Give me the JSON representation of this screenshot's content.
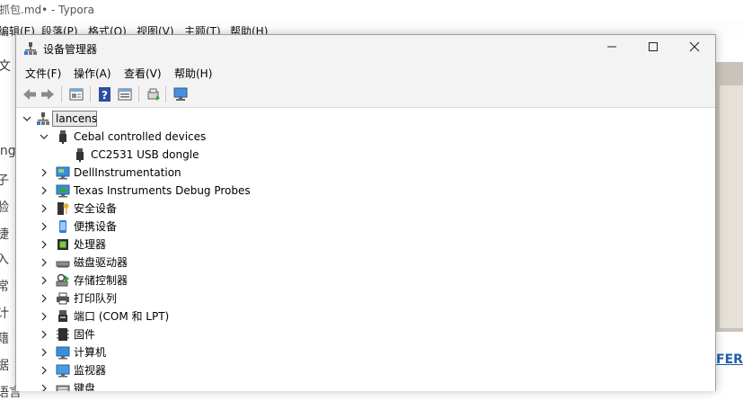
{
  "background_app": {
    "title": "抓包.md• - Typora",
    "menu": [
      "编辑(E)",
      "段落(P)",
      "格式(O)",
      "视图(V)",
      "主题(T)",
      "帮助(H)"
    ],
    "side_tab": "文",
    "side_chars": [
      "ing",
      "子",
      "验",
      "捷",
      "入",
      "常",
      "计",
      "籍",
      "据",
      "语言"
    ],
    "right_link": "FER"
  },
  "window": {
    "title": "设备管理器",
    "controls": {
      "minimize": "—",
      "maximize": "☐",
      "close": "✕"
    }
  },
  "menubar": [
    "文件(F)",
    "操作(A)",
    "查看(V)",
    "帮助(H)"
  ],
  "toolbar": {
    "icons": [
      "back-icon",
      "forward-icon",
      "properties-icon",
      "help-icon",
      "device-view-icon",
      "scan-hardware-icon",
      "monitor-icon"
    ]
  },
  "tree": {
    "root": "lancens",
    "nodes": [
      {
        "label": "Cebal controlled devices",
        "level": 1,
        "expanded": true,
        "icon": "usb-plug-icon"
      },
      {
        "label": "CC2531 USB dongle",
        "level": 2,
        "expanded": null,
        "icon": "usb-plug-icon"
      },
      {
        "label": "DellInstrumentation",
        "level": 1,
        "expanded": false,
        "icon": "dell-instrumentation-icon"
      },
      {
        "label": "Texas Instruments Debug Probes",
        "level": 1,
        "expanded": false,
        "icon": "debug-probe-icon"
      },
      {
        "label": "安全设备",
        "level": 1,
        "expanded": false,
        "icon": "security-device-icon"
      },
      {
        "label": "便携设备",
        "level": 1,
        "expanded": false,
        "icon": "portable-device-icon"
      },
      {
        "label": "处理器",
        "level": 1,
        "expanded": false,
        "icon": "processor-icon"
      },
      {
        "label": "磁盘驱动器",
        "level": 1,
        "expanded": false,
        "icon": "disk-drive-icon"
      },
      {
        "label": "存储控制器",
        "level": 1,
        "expanded": false,
        "icon": "storage-controller-icon"
      },
      {
        "label": "打印队列",
        "level": 1,
        "expanded": false,
        "icon": "printer-icon"
      },
      {
        "label": "端口 (COM 和 LPT)",
        "level": 1,
        "expanded": false,
        "icon": "port-icon"
      },
      {
        "label": "固件",
        "level": 1,
        "expanded": false,
        "icon": "firmware-icon"
      },
      {
        "label": "计算机",
        "level": 1,
        "expanded": false,
        "icon": "computer-icon"
      },
      {
        "label": "监视器",
        "level": 1,
        "expanded": false,
        "icon": "monitor-icon"
      },
      {
        "label": "键盘",
        "level": 1,
        "expanded": false,
        "icon": "keyboard-icon"
      }
    ]
  },
  "colors": {
    "accent_blue": "#2f7dd1",
    "chrome": "#f3f3f3",
    "selection": "#e8e8e8"
  }
}
